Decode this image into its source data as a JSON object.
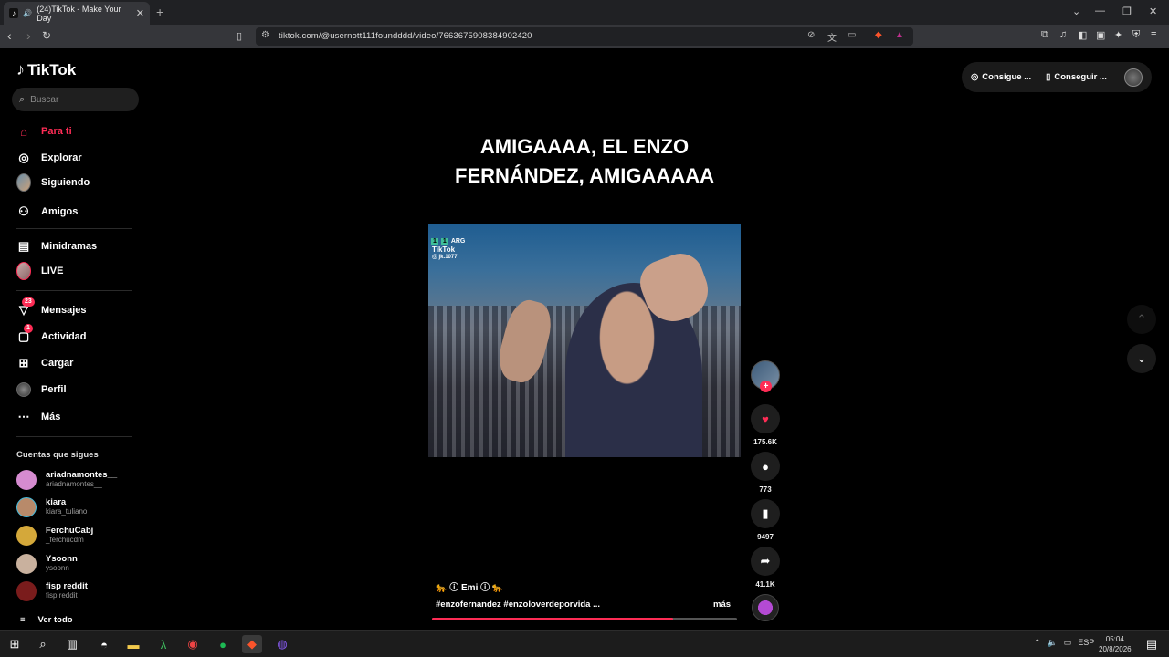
{
  "browser": {
    "tab_title": "(24)TikTok - Make Your Day",
    "tab_close": "✕",
    "new_tab": "+",
    "url": "tiktok.com/@usernott111foundddd/video/7663675908384902420",
    "window_controls": [
      "⌄",
      "—",
      "❐",
      "✕"
    ]
  },
  "sidebar": {
    "logo": "TikTok",
    "search_placeholder": "Buscar",
    "items": [
      {
        "label": "Para ti",
        "icon": "home-icon"
      },
      {
        "label": "Explorar",
        "icon": "compass-icon"
      },
      {
        "label": "Siguiendo",
        "icon": "following-avatar"
      },
      {
        "label": "Amigos",
        "icon": "friends-icon"
      },
      {
        "label": "Minidramas",
        "icon": "film-icon"
      },
      {
        "label": "LIVE",
        "icon": "live-avatar"
      },
      {
        "label": "Mensajes",
        "icon": "messages-icon",
        "badge": "23"
      },
      {
        "label": "Actividad",
        "icon": "activity-icon",
        "badge": "1"
      },
      {
        "label": "Cargar",
        "icon": "upload-icon"
      },
      {
        "label": "Perfil",
        "icon": "profile-avatar"
      },
      {
        "label": "Más",
        "icon": "more-icon"
      }
    ],
    "follows_title": "Cuentas que sigues",
    "accounts": [
      {
        "name": "ariadnamontes__",
        "handle": "ariadnamontes__",
        "color": "#d58bd0"
      },
      {
        "name": "kiara",
        "handle": "kiara_tuliano",
        "color": "#b88a6a"
      },
      {
        "name": "FerchuCabj",
        "handle": "_ferchucdm",
        "color": "#d4a83a"
      },
      {
        "name": "Ysoonn",
        "handle": "ysoonn",
        "color": "#c9b19e"
      },
      {
        "name": "fisp reddit",
        "handle": "fisp.reddit",
        "color": "#7a1c1c"
      }
    ],
    "see_all": "Ver todo"
  },
  "topright": {
    "coins_label": "Consigue ...",
    "app_label": "Conseguir ..."
  },
  "video": {
    "overlay_line1": "AMIGAAAA, EL ENZO",
    "overlay_line2": "FERNÁNDEZ,  AMIGAAAAA",
    "watermark_brand": "TikTok",
    "watermark_user": "@ jk.1077",
    "score_left": "1",
    "score_right": "1",
    "team": "ARG",
    "description_user": "🐆 ⓘ Emi ⓘ 🐆",
    "description_tags": "#enzofernandez #enzoloverdeporvida ...",
    "more": "más",
    "progress": 0.79
  },
  "actions": {
    "likes": "175.6K",
    "comments": "773",
    "saves": "9497",
    "shares": "41.1K"
  },
  "taskbar": {
    "lang": "ESP",
    "time": "05:04",
    "date": "20/8/2026"
  },
  "colors": {
    "accent": "#fe2c55",
    "background": "#000000",
    "sidebar_search": "#1f1f1f"
  }
}
